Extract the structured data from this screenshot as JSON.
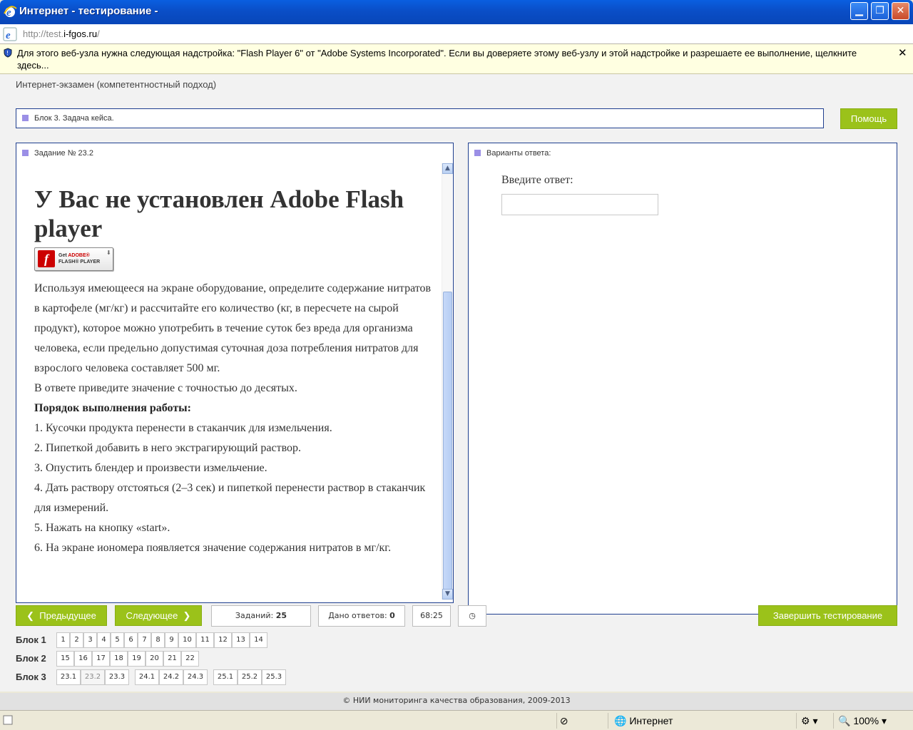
{
  "window": {
    "title": "Интернет - тестирование -",
    "url_prefix": "http://test.",
    "url_host": "i-fgos.ru",
    "url_suffix": "/"
  },
  "infobar": {
    "message": "Для этого веб-узла нужна следующая надстройка: \"Flash Player 6\" от \"Adobe Systems Incorporated\". Если вы доверяете этому веб-узлу и этой надстройке и разрешаете ее выполнение, щелкните здесь...",
    "close": "✕"
  },
  "app": {
    "title": "Интернет-экзамен (компетентностный подход)",
    "block_label": "Блок 3. Задача кейса.",
    "help_button": "Помощь"
  },
  "task": {
    "header": "Задание № 23.2",
    "flash_heading": "У Вас не установлен Adobe Flash player",
    "flash_badge_get": "Get",
    "flash_badge_adobe": "ADOBE®",
    "flash_badge_player": "FLASH® PLAYER",
    "paragraphs": [
      "Используя имеющееся на экране оборудование, определите содержание нитратов в картофеле (мг/кг) и рассчитайте его количество (кг, в пересчете на сырой продукт), которое можно употребить в течение суток без вреда для организма человека, если предельно допустимая суточная доза потребления нитратов для взрослого человека составляет 500 мг.",
      "В ответе приведите значение с точностью до десятых."
    ],
    "order_title": "Порядок выполнения работы:",
    "steps": [
      "1. Кусочки продукта перенести в стаканчик для измельчения.",
      "2. Пипеткой добавить в него экстрагирующий раствор.",
      "3. Опустить блендер и произвести измельчение.",
      "4. Дать раствору отстояться (2–3 сек) и пипеткой перенести раствор в стаканчик для измерений.",
      "5. Нажать на кнопку «start».",
      "6. На экране иономера появляется значение содержания нитратов в мг/кг."
    ]
  },
  "answers": {
    "header": "Варианты ответа:",
    "label": "Введите ответ:",
    "value": ""
  },
  "nav": {
    "prev": "Предыдущее",
    "next": "Следующее",
    "tasks_label": "Заданий:",
    "tasks_count": "25",
    "answered_label": "Дано ответов:",
    "answered_count": "0",
    "timer": "68:25",
    "finish": "Завершить тестирование"
  },
  "blocks": [
    {
      "label": "Блок 1",
      "items": [
        "1",
        "2",
        "3",
        "4",
        "5",
        "6",
        "7",
        "8",
        "9",
        "10",
        "11",
        "12",
        "13",
        "14"
      ]
    },
    {
      "label": "Блок 2",
      "items": [
        "15",
        "16",
        "17",
        "18",
        "19",
        "20",
        "21",
        "22"
      ]
    },
    {
      "label": "Блок 3",
      "items": [
        "23.1",
        "23.2",
        "23.3",
        "24.1",
        "24.2",
        "24.3",
        "25.1",
        "25.2",
        "25.3"
      ]
    }
  ],
  "current_item": "23.2",
  "footer": "© НИИ мониторинга качества образования, 2009-2013",
  "statusbar": {
    "zone": "Интернет",
    "zoom": "100%"
  }
}
